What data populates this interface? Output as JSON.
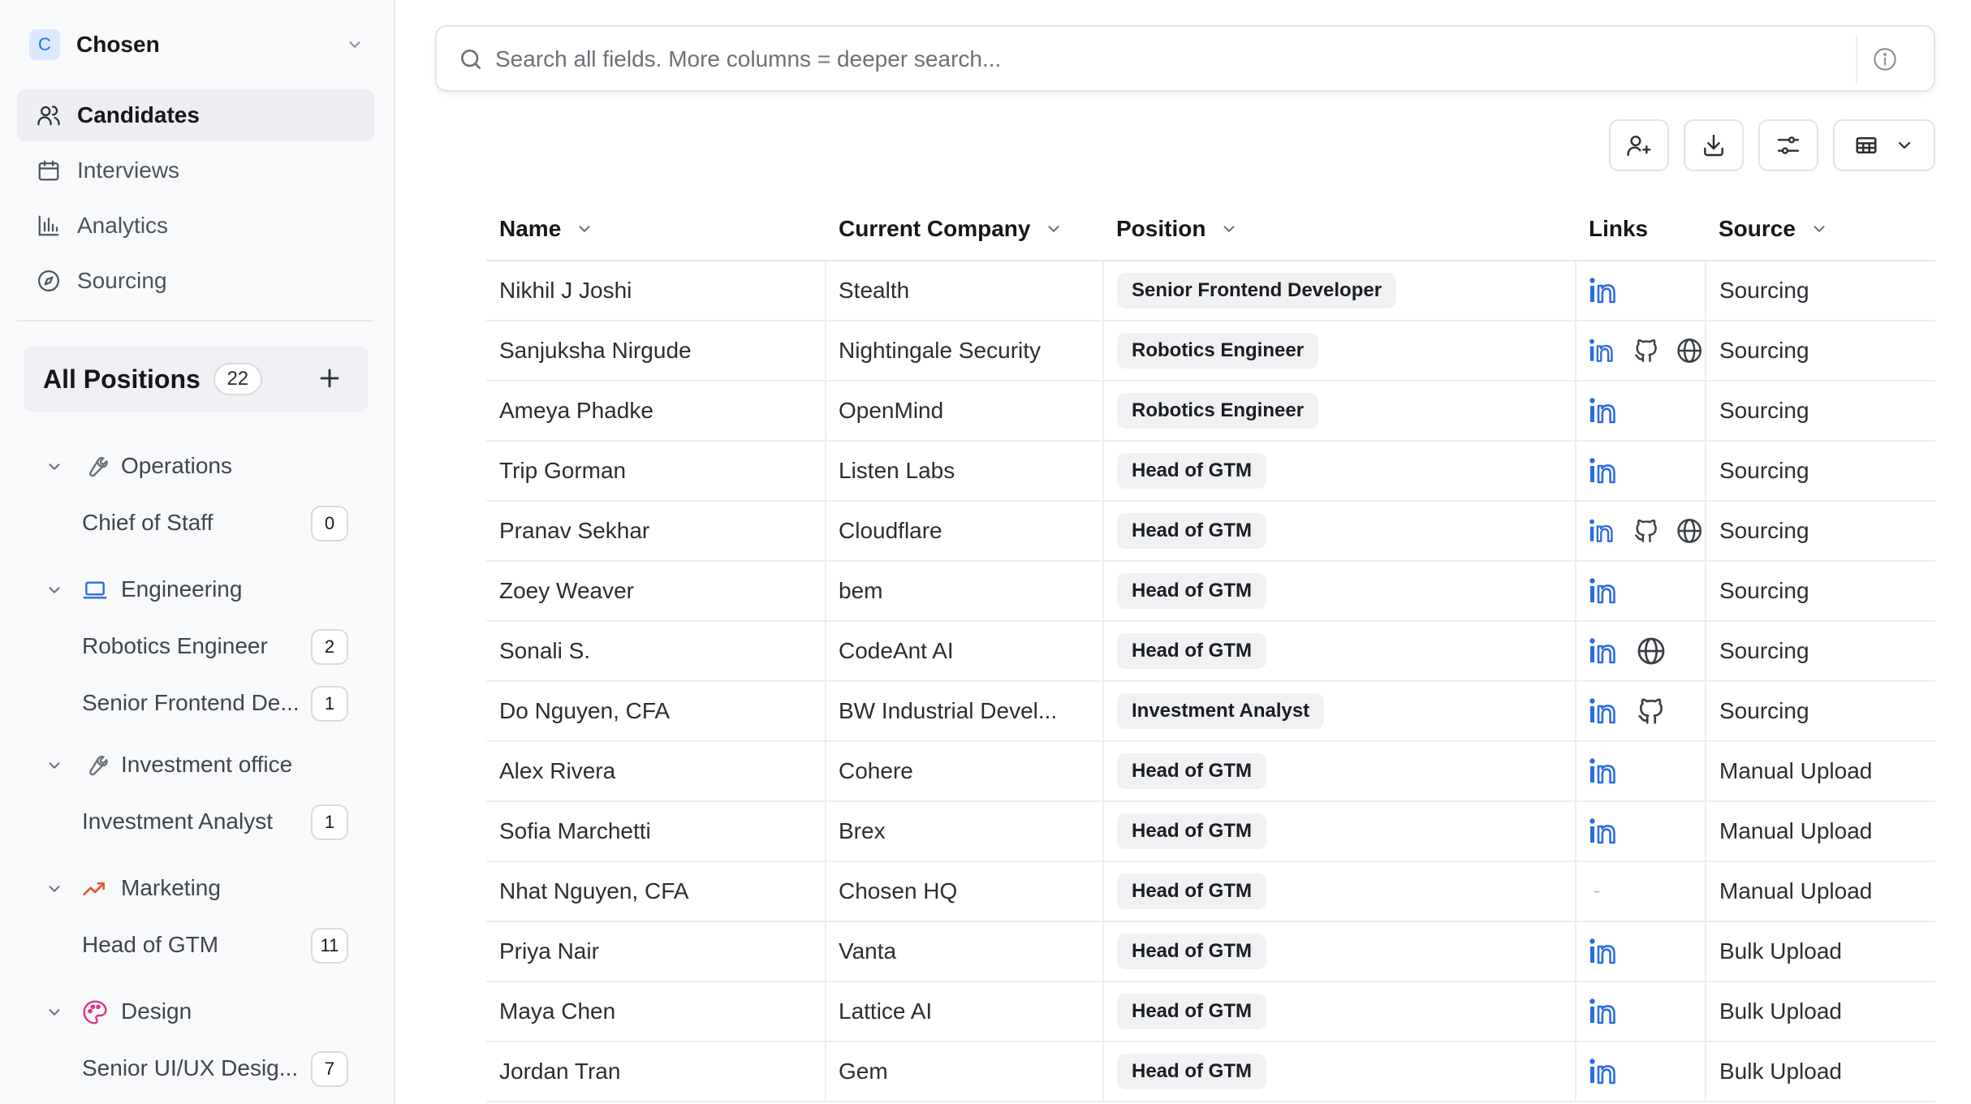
{
  "workspace": {
    "badge": "C",
    "name": "Chosen"
  },
  "nav": [
    {
      "label": "Candidates",
      "icon": "users-icon",
      "active": true
    },
    {
      "label": "Interviews",
      "icon": "calendar-icon",
      "active": false
    },
    {
      "label": "Analytics",
      "icon": "bar-chart-icon",
      "active": false
    },
    {
      "label": "Sourcing",
      "icon": "compass-icon",
      "active": false
    }
  ],
  "positions": {
    "label": "All Positions",
    "count": "22",
    "groups": [
      {
        "label": "Operations",
        "icon": "wrench-icon",
        "items": [
          {
            "label": "Chief of Staff",
            "count": "0"
          }
        ]
      },
      {
        "label": "Engineering",
        "icon": "laptop-icon",
        "items": [
          {
            "label": "Robotics Engineer",
            "count": "2"
          },
          {
            "label": "Senior Frontend De...",
            "count": "1"
          }
        ]
      },
      {
        "label": "Investment office",
        "icon": "wrench-icon",
        "items": [
          {
            "label": "Investment Analyst",
            "count": "1"
          }
        ]
      },
      {
        "label": "Marketing",
        "icon": "trending-up-icon",
        "items": [
          {
            "label": "Head of GTM",
            "count": "11"
          }
        ]
      },
      {
        "label": "Design",
        "icon": "palette-icon",
        "items": [
          {
            "label": "Senior UI/UX Desig...",
            "count": "7"
          }
        ]
      }
    ]
  },
  "search": {
    "placeholder": "Search all fields. More columns = deeper search..."
  },
  "toolbar": [
    "add-candidate-icon",
    "download-icon",
    "filter-settings-icon",
    "table-view-icon"
  ],
  "table": {
    "columns": {
      "name": "Name",
      "company": "Current Company",
      "position": "Position",
      "links": "Links",
      "source": "Source"
    },
    "rows": [
      {
        "name": "Nikhil J Joshi",
        "company": "Stealth",
        "position": "Senior Frontend Developer",
        "links": [
          "linkedin"
        ],
        "source": "Sourcing"
      },
      {
        "name": "Sanjuksha Nirgude",
        "company": "Nightingale Security",
        "position": "Robotics Engineer",
        "links": [
          "linkedin",
          "github",
          "website"
        ],
        "source": "Sourcing"
      },
      {
        "name": "Ameya Phadke",
        "company": "OpenMind",
        "position": "Robotics Engineer",
        "links": [
          "linkedin"
        ],
        "source": "Sourcing"
      },
      {
        "name": "Trip Gorman",
        "company": "Listen Labs",
        "position": "Head of GTM",
        "links": [
          "linkedin"
        ],
        "source": "Sourcing"
      },
      {
        "name": "Pranav Sekhar",
        "company": "Cloudflare",
        "position": "Head of GTM",
        "links": [
          "linkedin",
          "github",
          "website"
        ],
        "source": "Sourcing"
      },
      {
        "name": "Zoey Weaver",
        "company": "bem",
        "position": "Head of GTM",
        "links": [
          "linkedin"
        ],
        "source": "Sourcing"
      },
      {
        "name": "Sonali S.",
        "company": "CodeAnt AI",
        "position": "Head of GTM",
        "links": [
          "linkedin",
          "website"
        ],
        "source": "Sourcing"
      },
      {
        "name": "Do Nguyen, CFA",
        "company": "BW Industrial Devel...",
        "position": "Investment Analyst",
        "links": [
          "linkedin",
          "github"
        ],
        "source": "Sourcing"
      },
      {
        "name": "Alex Rivera",
        "company": "Cohere",
        "position": "Head of GTM",
        "links": [
          "linkedin"
        ],
        "source": "Manual Upload"
      },
      {
        "name": "Sofia Marchetti",
        "company": "Brex",
        "position": "Head of GTM",
        "links": [
          "linkedin"
        ],
        "source": "Manual Upload"
      },
      {
        "name": "Nhat Nguyen, CFA",
        "company": "Chosen HQ",
        "position": "Head of GTM",
        "links": [],
        "empty_link_text": "-",
        "source": "Manual Upload"
      },
      {
        "name": "Priya Nair",
        "company": "Vanta",
        "position": "Head of GTM",
        "links": [
          "linkedin"
        ],
        "source": "Bulk Upload"
      },
      {
        "name": "Maya Chen",
        "company": "Lattice AI",
        "position": "Head of GTM",
        "links": [
          "linkedin"
        ],
        "source": "Bulk Upload"
      },
      {
        "name": "Jordan Tran",
        "company": "Gem",
        "position": "Head of GTM",
        "links": [
          "linkedin"
        ],
        "source": "Bulk Upload"
      }
    ]
  },
  "colors": {
    "accent": "#2b6de0",
    "linkedin": "#2b6de0",
    "marketing": "#e8552b",
    "design": "#e0328a"
  }
}
